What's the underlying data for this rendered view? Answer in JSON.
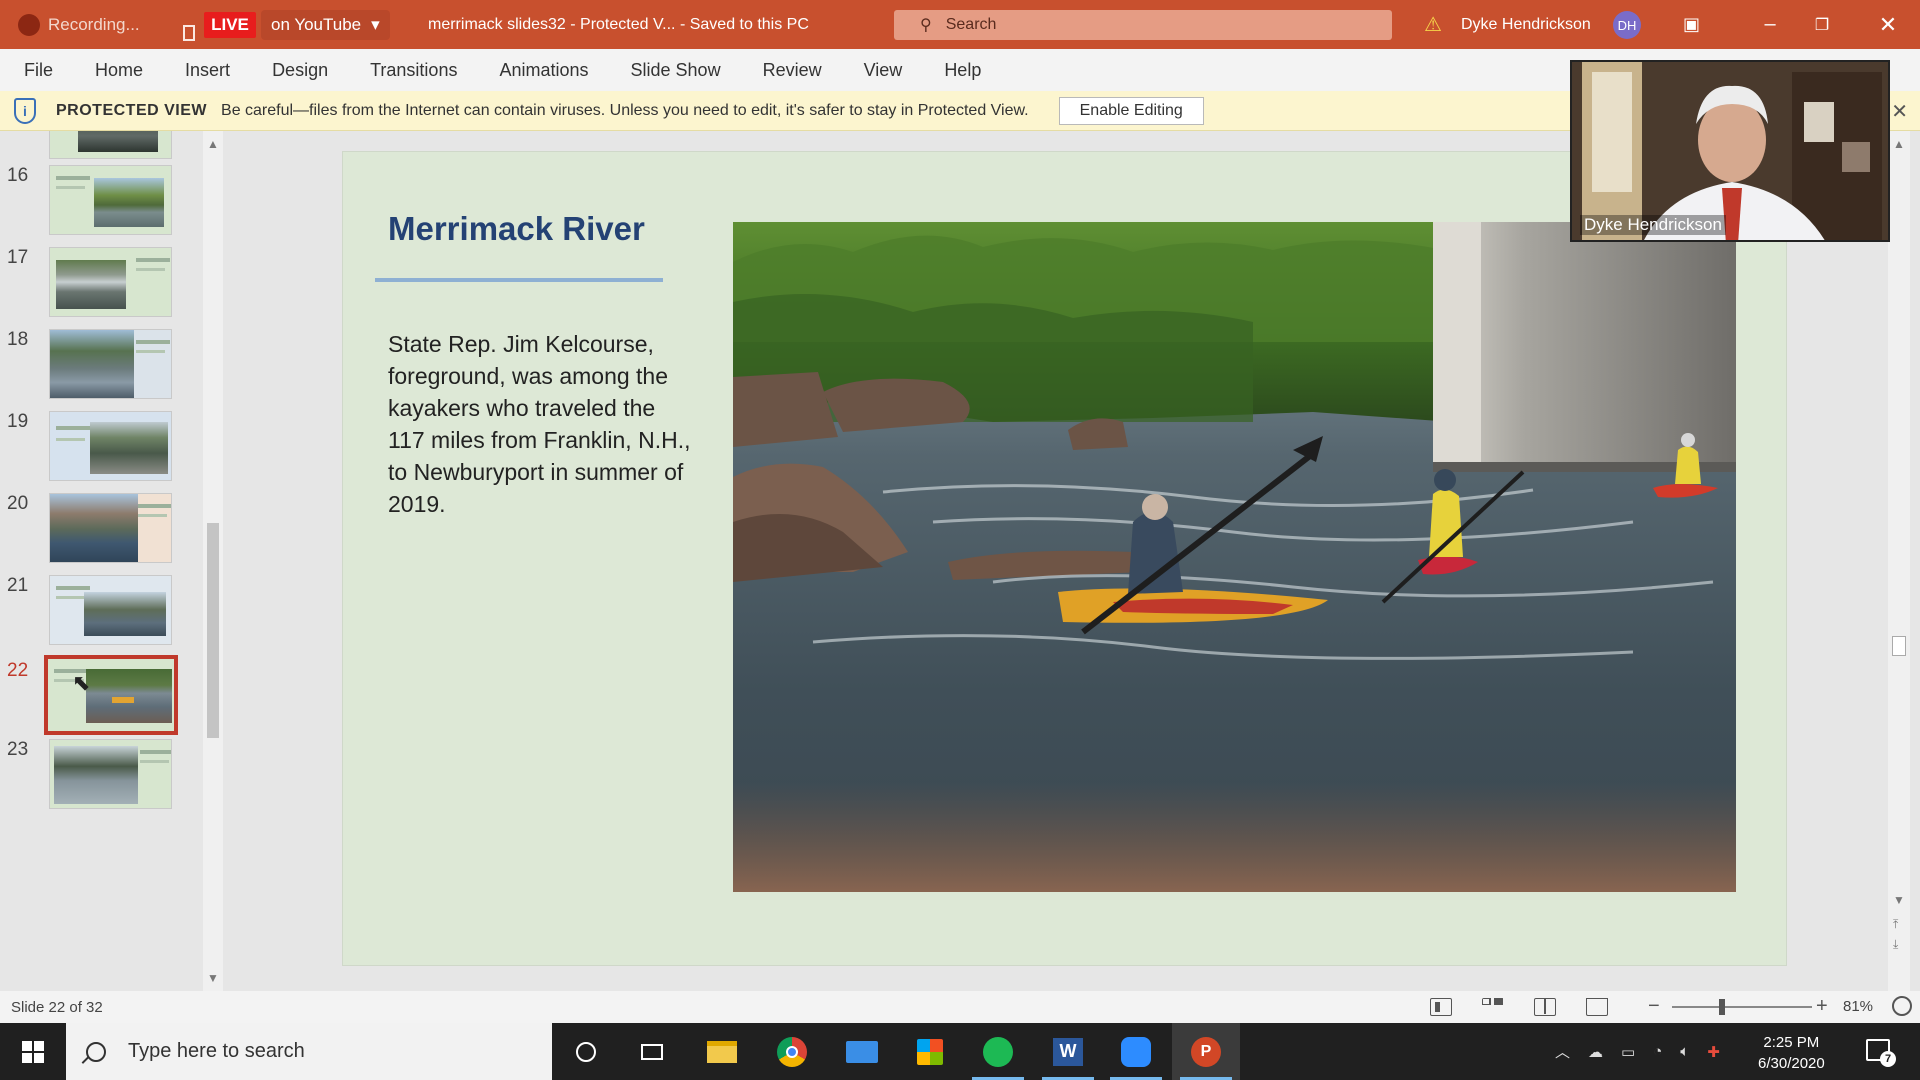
{
  "titlebar": {
    "recording_label": "Recording...",
    "live_label": "LIVE",
    "youtube_label": "on YouTube",
    "doc_title": "merrimack slides32  -  Protected V...  -  Saved to this PC",
    "search_placeholder": "Search",
    "user_name": "Dyke Hendrickson",
    "user_initials": "DH"
  },
  "menu": [
    "File",
    "Home",
    "Insert",
    "Design",
    "Transitions",
    "Animations",
    "Slide Show",
    "Review",
    "View",
    "Help"
  ],
  "protected_view": {
    "title": "PROTECTED VIEW",
    "message": "Be careful—files from the Internet can contain viruses. Unless you need to edit, it's safer to stay in Protected View.",
    "button": "Enable Editing"
  },
  "thumbnails": [
    {
      "num": "16"
    },
    {
      "num": "17"
    },
    {
      "num": "18"
    },
    {
      "num": "19"
    },
    {
      "num": "20"
    },
    {
      "num": "21"
    },
    {
      "num": "22",
      "active": true
    },
    {
      "num": "23"
    }
  ],
  "slide": {
    "title": "Merrimack River",
    "body": "State Rep. Jim Kelcourse, foreground, was among the kayakers who traveled the 117 miles from Franklin, N.H., to Newburyport in summer of 2019."
  },
  "webcam": {
    "name": "Dyke Hendrickson"
  },
  "status": {
    "slide_count": "Slide 22 of 32",
    "zoom": "81%",
    "zoom_fraction": 0.36
  },
  "taskbar": {
    "search_placeholder": "Type here to search",
    "time": "2:25 PM",
    "date": "6/30/2020",
    "notifications": "7"
  },
  "colors": {
    "accent_title_bar": "#c8502e",
    "live_red": "#e81d1d",
    "slide_title": "#244274",
    "slide_bg": "#dde8d6",
    "active_thumb_border": "#c0392b"
  }
}
